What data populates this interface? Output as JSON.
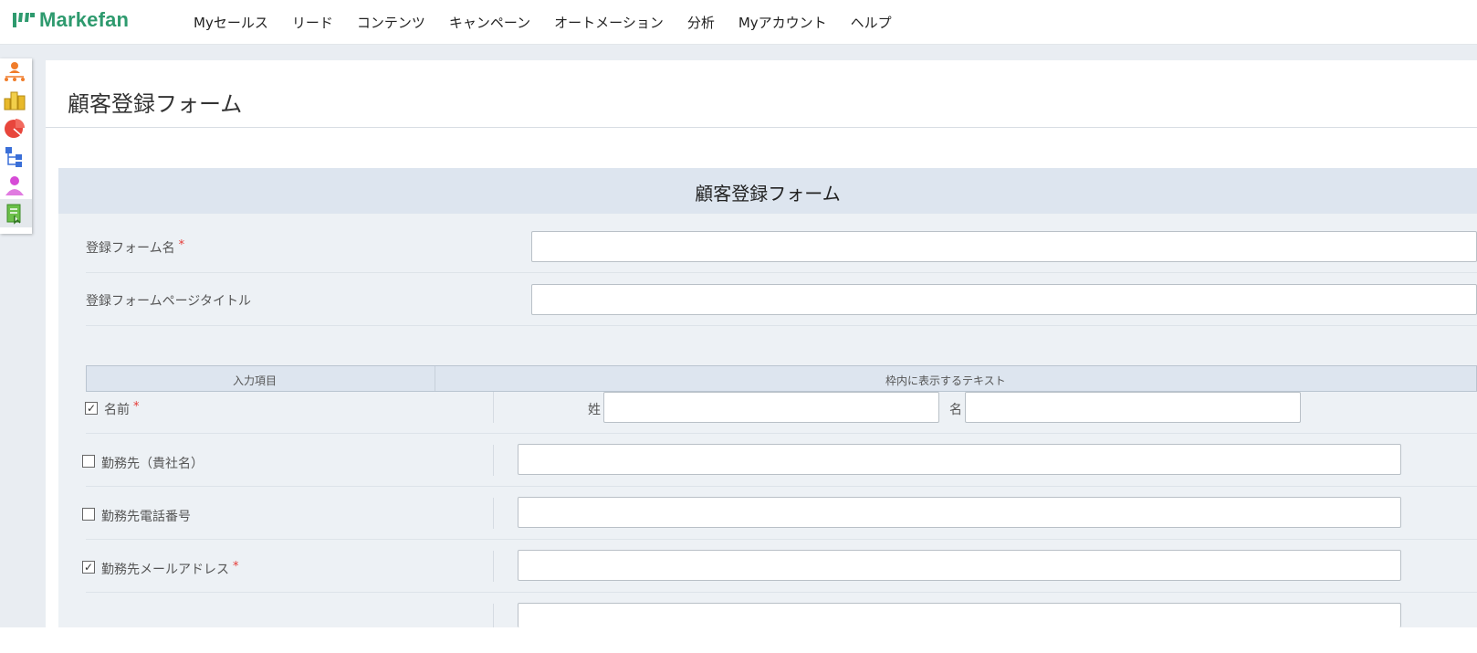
{
  "app": {
    "logo_text": "Markefan"
  },
  "nav": {
    "items": [
      "Myセールス",
      "リード",
      "コンテンツ",
      "キャンペーン",
      "オートメーション",
      "分析",
      "Myアカウント",
      "ヘルプ"
    ]
  },
  "sidebar": {
    "icons": [
      "org-chart-icon",
      "bar-chart-icon",
      "pie-chart-icon",
      "tree-icon",
      "user-icon",
      "form-document-icon"
    ],
    "active_index": 5
  },
  "page": {
    "title": "顧客登録フォーム"
  },
  "form": {
    "header_title": "顧客登録フォーム",
    "fields": {
      "form_name": {
        "label": "登録フォーム名",
        "required_mark": "*",
        "value": ""
      },
      "page_title": {
        "label": "登録フォームページタイトル",
        "value": ""
      }
    },
    "table": {
      "col1": "入力項目",
      "col2": "枠内に表示するテキスト",
      "rows": [
        {
          "label": "名前",
          "checked": true,
          "required_mark": "*",
          "sub": [
            "姓",
            "名"
          ]
        },
        {
          "label": "勤務先（貴社名）",
          "checked": false
        },
        {
          "label": "勤務先電話番号",
          "checked": false
        },
        {
          "label": "勤務先メールアドレス",
          "checked": true,
          "required_mark": "*"
        }
      ]
    }
  },
  "colors": {
    "brand": "#2e9a6e",
    "required": "#e53935",
    "header_bg": "#dde5ef",
    "card_bg": "#edf1f5"
  }
}
